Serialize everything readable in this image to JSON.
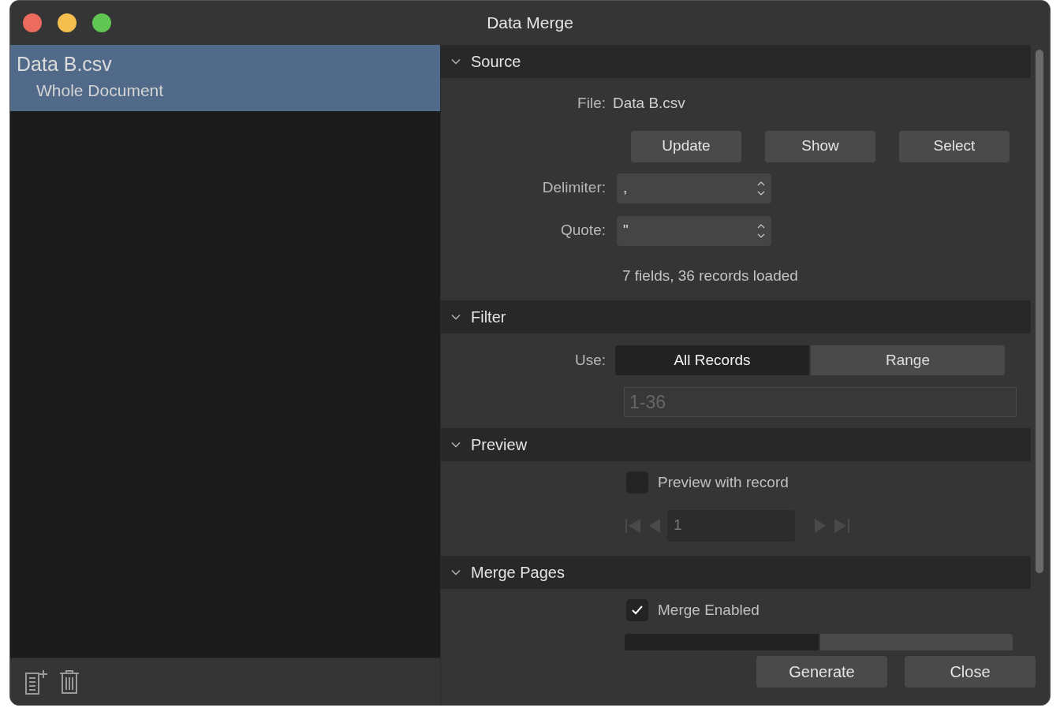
{
  "window": {
    "title": "Data Merge"
  },
  "sidebar": {
    "items": [
      {
        "label": "Data B.csv",
        "selected": true,
        "children": [
          {
            "label": "Whole Document"
          }
        ]
      }
    ]
  },
  "source": {
    "title": "Source",
    "expanded": true,
    "file_label": "File:",
    "file_value": "Data B.csv",
    "buttons": [
      "Update",
      "Show",
      "Select"
    ],
    "delimiter": {
      "label": "Delimiter:",
      "value": ","
    },
    "quote": {
      "label": "Quote:",
      "value": "\""
    },
    "status": "7 fields, 36 records loaded"
  },
  "filter": {
    "title": "Filter",
    "expanded": true,
    "use_label": "Use:",
    "options": [
      {
        "label": "All Records",
        "selected": true
      },
      {
        "label": "Range",
        "selected": false
      }
    ],
    "range": {
      "value": "1-36",
      "disabled": true
    }
  },
  "preview": {
    "title": "Preview",
    "expanded": true,
    "checkbox": {
      "label": "Preview with record",
      "checked": false
    },
    "record": {
      "value": "1",
      "disabled": true
    }
  },
  "merge_pages": {
    "title": "Merge Pages",
    "expanded": true,
    "checkbox": {
      "label": "Merge Enabled",
      "checked": true
    }
  },
  "footer": {
    "buttons": [
      "Generate",
      "Close"
    ]
  }
}
